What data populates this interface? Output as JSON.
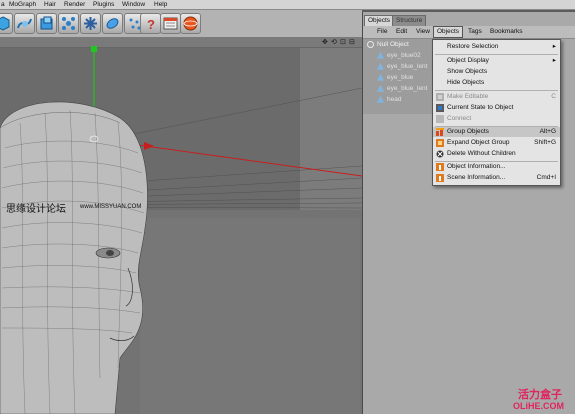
{
  "menubar": {
    "items": [
      "a",
      "MoGraph",
      "Hair",
      "Render",
      "Plugins",
      "Window",
      "Help"
    ]
  },
  "viewport": {
    "nav_icons": [
      "✥",
      "⟲",
      "⊡",
      "⊟"
    ]
  },
  "panel": {
    "tabs": [
      "Objects",
      "Structure"
    ],
    "menu": [
      "File",
      "Edit",
      "View",
      "Objects",
      "Tags",
      "Bookmarks"
    ]
  },
  "tree": {
    "items": [
      {
        "label": "Null Object"
      },
      {
        "label": "eye_blue02"
      },
      {
        "label": "eye_blue_lent"
      },
      {
        "label": "eye_blue"
      },
      {
        "label": "eye_blue_lent"
      },
      {
        "label": "head"
      }
    ]
  },
  "dropdown": {
    "items": [
      {
        "label": "Restore Selection",
        "shortcut": "",
        "submenu": true,
        "disabled": false,
        "icon": ""
      },
      {
        "label": "Object Display",
        "shortcut": "",
        "submenu": true,
        "disabled": false,
        "icon": ""
      },
      {
        "label": "Show Objects",
        "shortcut": "",
        "submenu": false,
        "disabled": false,
        "icon": ""
      },
      {
        "label": "Hide Objects",
        "shortcut": "",
        "submenu": false,
        "disabled": false,
        "icon": ""
      },
      {
        "label": "Make Editable",
        "shortcut": "C",
        "submenu": false,
        "disabled": true,
        "icon": "make-editable-icon"
      },
      {
        "label": "Current State to Object",
        "shortcut": "",
        "submenu": false,
        "disabled": false,
        "icon": "current-state-icon"
      },
      {
        "label": "Connect",
        "shortcut": "",
        "submenu": false,
        "disabled": true,
        "icon": "connect-icon"
      },
      {
        "label": "Group Objects",
        "shortcut": "Alt+G",
        "submenu": false,
        "disabled": false,
        "icon": "group-objects-icon",
        "highlighted": true
      },
      {
        "label": "Expand Object Group",
        "shortcut": "Shift+G",
        "submenu": false,
        "disabled": false,
        "icon": "expand-group-icon"
      },
      {
        "label": "Delete Without Children",
        "shortcut": "",
        "submenu": false,
        "disabled": false,
        "icon": "delete-without-children-icon"
      },
      {
        "label": "Object Information...",
        "shortcut": "",
        "submenu": false,
        "disabled": false,
        "icon": "object-info-icon"
      },
      {
        "label": "Scene Information...",
        "shortcut": "Cmd+I",
        "submenu": false,
        "disabled": false,
        "icon": "scene-info-icon"
      }
    ]
  },
  "watermarks": {
    "left_cn": "思缘设计论坛",
    "left_url": "www.MISSYUAN.COM",
    "bottom_cn": "活力盒子",
    "bottom_url": "OLiHE.COM"
  },
  "colors": {
    "menu_highlight": "#c6c6c6",
    "x_axis": "#c81e1e",
    "y_axis": "#1ec81e",
    "z_axis": "#1e3cc8",
    "watermark_red": "#e0245e"
  }
}
